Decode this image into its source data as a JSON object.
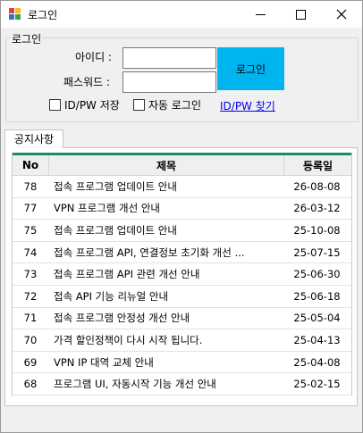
{
  "window": {
    "title": "로그인"
  },
  "login": {
    "group_title": "로그인",
    "id_label": "아이디 :",
    "pw_label": "패스워드 :",
    "id_value": "",
    "pw_value": "",
    "login_button": "로그인",
    "save_idpw": "ID/PW 저장",
    "auto_login": "자동 로그인",
    "find_link": "ID/PW 찾기",
    "colors": {
      "login_button_bg": "#00b4f0",
      "link": "#0000ee"
    }
  },
  "notice": {
    "tab_label": "공지사항",
    "headers": {
      "no": "No",
      "title": "제목",
      "date": "등록일"
    },
    "rows": [
      {
        "no": "78",
        "title": "접속 프로그램 업데이트 안내",
        "date": "26-08-08"
      },
      {
        "no": "77",
        "title": "VPN 프로그램 개선 안내",
        "date": "26-03-12"
      },
      {
        "no": "75",
        "title": "접속 프로그램 업데이트 안내",
        "date": "25-10-08"
      },
      {
        "no": "74",
        "title": "접속 프로그램 API, 연결정보 초기화 개선 ...",
        "date": "25-07-15"
      },
      {
        "no": "73",
        "title": "접속 프로그램 API 관련 개선 안내",
        "date": "25-06-30"
      },
      {
        "no": "72",
        "title": "접속 API 기능 리뉴얼 안내",
        "date": "25-06-18"
      },
      {
        "no": "71",
        "title": "접속 프로그램 안정성 개선 안내",
        "date": "25-05-04"
      },
      {
        "no": "70",
        "title": "가격 할인정책이 다시 시작 됩니다.",
        "date": "25-04-13"
      },
      {
        "no": "69",
        "title": "VPN IP 대역 교체 안내",
        "date": "25-04-08"
      },
      {
        "no": "68",
        "title": "프로그램 UI, 자동시작 기능 개선 안내",
        "date": "25-02-15"
      }
    ],
    "colors": {
      "header_accent": "#1a8a6a"
    }
  }
}
